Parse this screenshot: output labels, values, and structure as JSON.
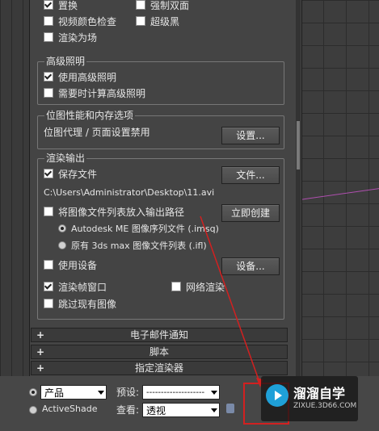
{
  "top_options": {
    "displacement": "置换",
    "force_two_sided": "强制双面",
    "video_color_check": "视频颜色检查",
    "super_black": "超级黑",
    "render_to_fields": "渲染为场"
  },
  "advanced_lighting": {
    "title": "高级照明",
    "use_advanced": "使用高级照明",
    "compute_when_required": "需要时计算高级照明"
  },
  "bitmap": {
    "title": "位图性能和内存选项",
    "proxy_text": "位图代理 / 页面设置禁用",
    "setup_button": "设置..."
  },
  "render_output": {
    "title": "渲染输出",
    "save_file": "保存文件",
    "file_button": "文件...",
    "path": "C:\\Users\\Administrator\\Desktop\\11.avi",
    "put_in_output_path": "将图像文件列表放入输出路径",
    "create_now_button": "立即创建",
    "option_autodesk": "Autodesk ME 图像序列文件 (.imsq)",
    "option_legacy": "原有 3ds max 图像文件列表 (.ifl)",
    "use_device": "使用设备",
    "device_button": "设备...",
    "rendered_frame_window": "渲染帧窗口",
    "net_render": "网络渲染",
    "skip_existing": "跳过现有图像"
  },
  "rollouts": [
    "电子邮件通知",
    "脚本",
    "指定渲染器"
  ],
  "bottom": {
    "mode_product": "产品",
    "mode_activeshade": "ActiveShade",
    "preset_label": "预设:",
    "preset_value": "--------------------",
    "view_label": "查看:",
    "view_value": "透视"
  },
  "watermark": {
    "title": "溜溜自学",
    "subtitle": "ZIXUE.3D66.COM"
  },
  "colors": {
    "panel": "#444444",
    "accent_red": "#d22020",
    "brand_blue": "#1fa0d8"
  }
}
